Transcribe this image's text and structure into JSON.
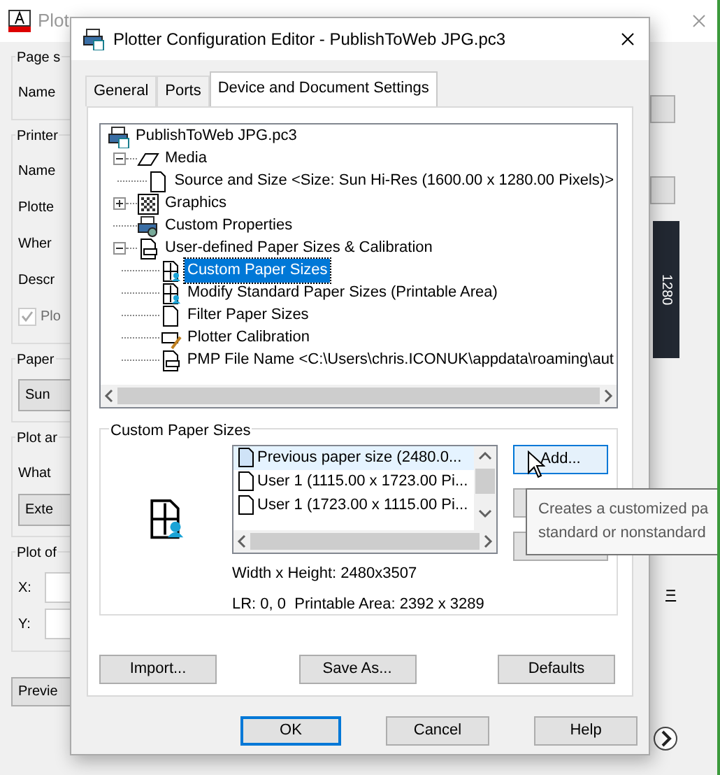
{
  "background_window": {
    "title": "Plot",
    "groups": [
      {
        "title": "Page s",
        "rows": [
          {
            "kind": "label",
            "text": "Name"
          }
        ]
      },
      {
        "title": "Printer",
        "rows": [
          {
            "kind": "label",
            "text": "Name"
          },
          {
            "kind": "label",
            "text": "Plotte"
          },
          {
            "kind": "label",
            "text": "Wher"
          },
          {
            "kind": "label",
            "text": "Descr"
          },
          {
            "kind": "checkbox",
            "text": "Plo",
            "checked": true
          }
        ]
      },
      {
        "title": "Paper",
        "rows": [
          {
            "kind": "combo",
            "text": "Sun"
          }
        ]
      },
      {
        "title": "Plot ar",
        "rows": [
          {
            "kind": "label",
            "text": "What"
          },
          {
            "kind": "combo",
            "text": "Exte"
          }
        ]
      },
      {
        "title": "Plot of",
        "rows": [
          {
            "kind": "field",
            "text": "X:"
          },
          {
            "kind": "field",
            "text": "Y:"
          }
        ]
      }
    ],
    "preview_button": "Previe",
    "preview_dimension": "1280",
    "equals_link": "="
  },
  "dialog": {
    "title": "Plotter Configuration Editor - PublishToWeb JPG.pc3",
    "tabs": [
      {
        "label": "General",
        "selected": false
      },
      {
        "label": "Ports",
        "selected": false
      },
      {
        "label": "Device and Document Settings",
        "selected": true
      }
    ],
    "tree": [
      {
        "label": "PublishToWeb JPG.pc3",
        "kind": "printer",
        "selected": false,
        "children": [
          {
            "label": "Media",
            "kind": "media",
            "selected": false,
            "expanded": true,
            "children": [
              {
                "label": "Source and Size <Size: Sun Hi-Res (1600.00 x 1280.00 Pixels)>",
                "kind": "sheet",
                "selected": false
              }
            ]
          },
          {
            "label": "Graphics",
            "kind": "graphics",
            "selected": false,
            "expanded": false
          },
          {
            "label": "Custom Properties",
            "kind": "properties",
            "selected": false
          },
          {
            "label": "User-defined Paper Sizes & Calibration",
            "kind": "paper",
            "selected": false,
            "expanded": true,
            "children": [
              {
                "label": "Custom Paper Sizes",
                "kind": "custom",
                "selected": true
              },
              {
                "label": "Modify Standard Paper Sizes (Printable Area)",
                "kind": "custom",
                "selected": false
              },
              {
                "label": "Filter Paper Sizes",
                "kind": "sheet",
                "selected": false
              },
              {
                "label": "Plotter Calibration",
                "kind": "calibration",
                "selected": false
              },
              {
                "label": "PMP File Name <C:\\Users\\chris.ICONUK\\appdata\\roaming\\aut",
                "kind": "paper",
                "selected": false
              }
            ]
          }
        ]
      }
    ],
    "custom_paper_sizes": {
      "title": "Custom Paper Sizes",
      "items": [
        {
          "label": "Previous paper size  (2480.0...",
          "selected": true
        },
        {
          "label": "User 1 (1115.00 x 1723.00 Pi...",
          "selected": false
        },
        {
          "label": "User 1 (1723.00 x 1115.00 Pi...",
          "selected": false
        }
      ],
      "add_button": "Add...",
      "width_height": "Width x Height: 2480x3507",
      "printable": "LR: 0, 0  Printable Area: 2392 x 3289"
    },
    "tooltip": [
      "Creates a customized pa",
      "standard or nonstandard"
    ],
    "file_buttons": [
      "Import...",
      "Save As...",
      "Defaults"
    ],
    "footer_buttons": [
      "OK",
      "Cancel",
      "Help"
    ]
  }
}
